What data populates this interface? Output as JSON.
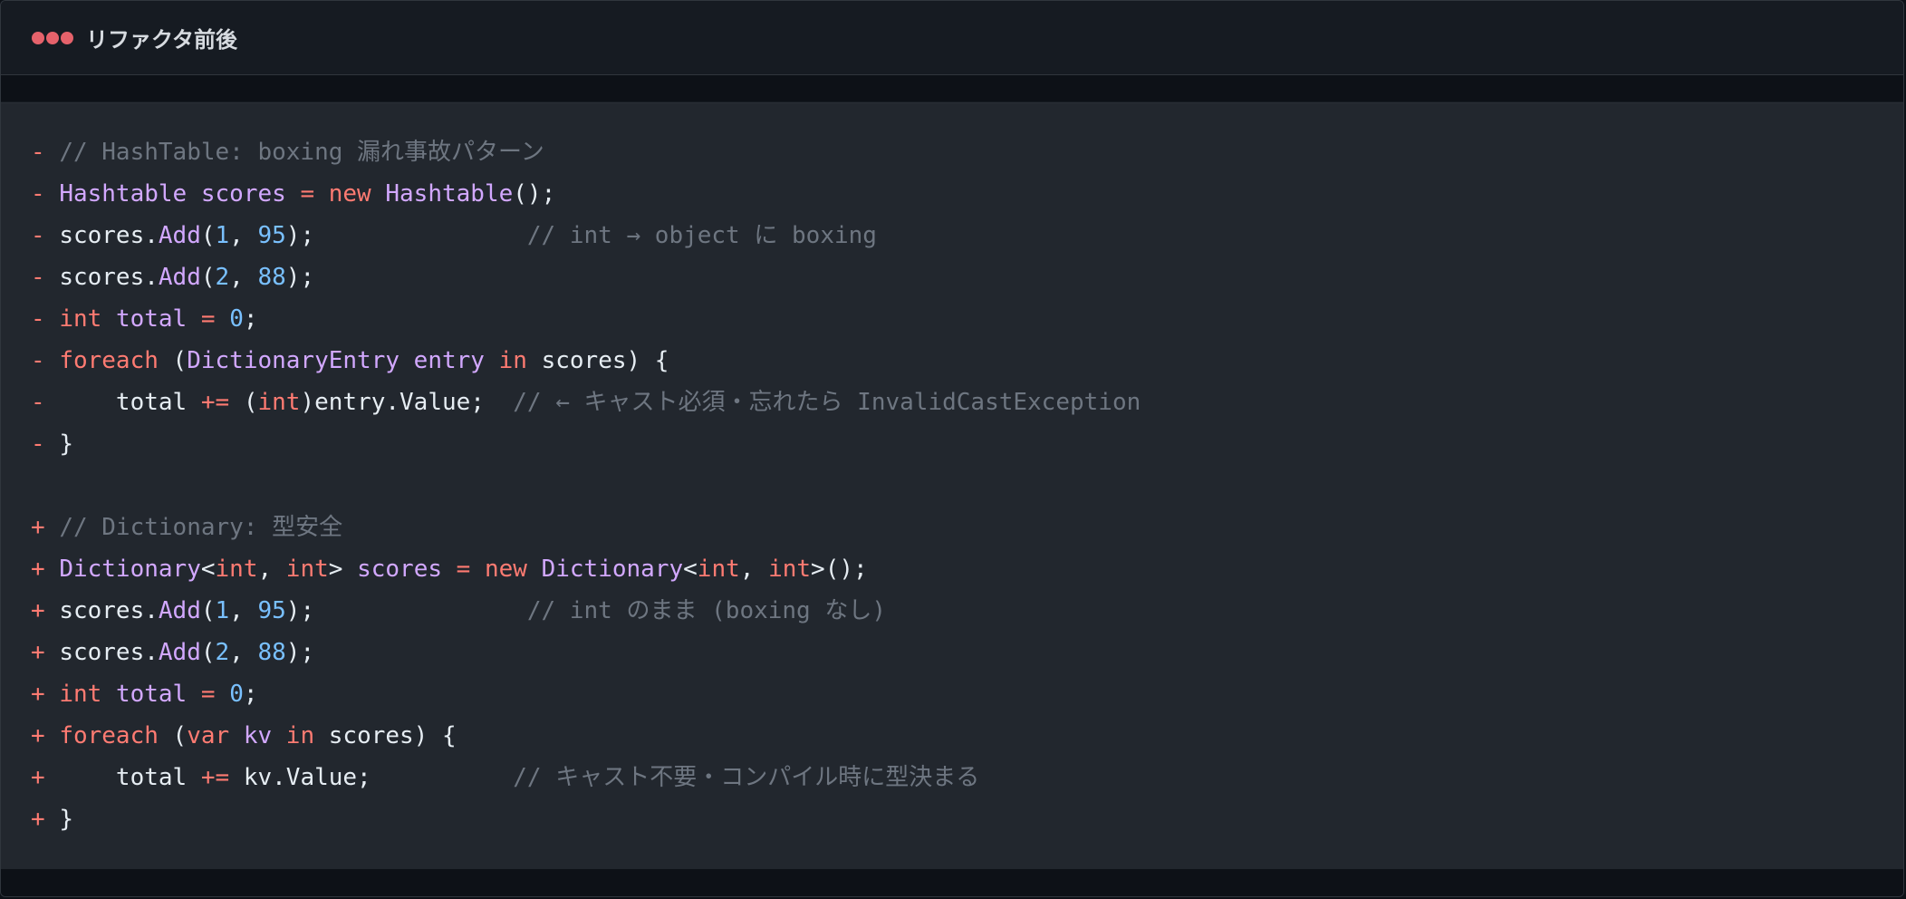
{
  "window": {
    "title": "リファクタ前後"
  },
  "colors": {
    "background": "#22272e",
    "titlebar": "#161b22",
    "diff_sign": "#ff7b72",
    "comment": "#6e7681",
    "type": "#d2a8ff",
    "keyword": "#ff7b72",
    "number": "#79c0ff",
    "plain": "#e6edf3"
  },
  "code": {
    "removed": [
      {
        "sign": "-",
        "tokens": [
          [
            "cm",
            "// HashTable: boxing 漏れ事故パターン"
          ]
        ]
      },
      {
        "sign": "-",
        "tokens": [
          [
            "ty",
            "Hashtable"
          ],
          [
            "tx",
            " "
          ],
          [
            "ty",
            "scores"
          ],
          [
            "tx",
            " "
          ],
          [
            "op",
            "="
          ],
          [
            "tx",
            " "
          ],
          [
            "kw",
            "new"
          ],
          [
            "tx",
            " "
          ],
          [
            "ty",
            "Hashtable"
          ],
          [
            "tx",
            "();"
          ]
        ]
      },
      {
        "sign": "-",
        "tokens": [
          [
            "tx",
            "scores."
          ],
          [
            "fn",
            "Add"
          ],
          [
            "tx",
            "("
          ],
          [
            "nm",
            "1"
          ],
          [
            "tx",
            ", "
          ],
          [
            "nm",
            "95"
          ],
          [
            "tx",
            ");               "
          ],
          [
            "cm",
            "// int → object に boxing"
          ]
        ]
      },
      {
        "sign": "-",
        "tokens": [
          [
            "tx",
            "scores."
          ],
          [
            "fn",
            "Add"
          ],
          [
            "tx",
            "("
          ],
          [
            "nm",
            "2"
          ],
          [
            "tx",
            ", "
          ],
          [
            "nm",
            "88"
          ],
          [
            "tx",
            ");"
          ]
        ]
      },
      {
        "sign": "-",
        "tokens": [
          [
            "kw",
            "int"
          ],
          [
            "tx",
            " "
          ],
          [
            "ty",
            "total"
          ],
          [
            "tx",
            " "
          ],
          [
            "op",
            "="
          ],
          [
            "tx",
            " "
          ],
          [
            "nm",
            "0"
          ],
          [
            "tx",
            ";"
          ]
        ]
      },
      {
        "sign": "-",
        "tokens": [
          [
            "kw",
            "foreach"
          ],
          [
            "tx",
            " ("
          ],
          [
            "ty",
            "DictionaryEntry"
          ],
          [
            "tx",
            " "
          ],
          [
            "ty",
            "entry"
          ],
          [
            "tx",
            " "
          ],
          [
            "kw",
            "in"
          ],
          [
            "tx",
            " scores) {"
          ]
        ]
      },
      {
        "sign": "-",
        "tokens": [
          [
            "tx",
            "    total "
          ],
          [
            "op",
            "+="
          ],
          [
            "tx",
            " ("
          ],
          [
            "kw",
            "int"
          ],
          [
            "tx",
            ")entry.Value;  "
          ],
          [
            "cm",
            "// ← キャスト必須・忘れたら InvalidCastException"
          ]
        ]
      },
      {
        "sign": "-",
        "tokens": [
          [
            "tx",
            "}"
          ]
        ]
      }
    ],
    "added": [
      {
        "sign": "+",
        "tokens": [
          [
            "cm",
            "// Dictionary: 型安全"
          ]
        ]
      },
      {
        "sign": "+",
        "tokens": [
          [
            "ty",
            "Dictionary"
          ],
          [
            "tx",
            "<"
          ],
          [
            "kw",
            "int"
          ],
          [
            "tx",
            ", "
          ],
          [
            "kw",
            "int"
          ],
          [
            "tx",
            "> "
          ],
          [
            "ty",
            "scores"
          ],
          [
            "tx",
            " "
          ],
          [
            "op",
            "="
          ],
          [
            "tx",
            " "
          ],
          [
            "kw",
            "new"
          ],
          [
            "tx",
            " "
          ],
          [
            "ty",
            "Dictionary"
          ],
          [
            "tx",
            "<"
          ],
          [
            "kw",
            "int"
          ],
          [
            "tx",
            ", "
          ],
          [
            "kw",
            "int"
          ],
          [
            "tx",
            ">();"
          ]
        ]
      },
      {
        "sign": "+",
        "tokens": [
          [
            "tx",
            "scores."
          ],
          [
            "fn",
            "Add"
          ],
          [
            "tx",
            "("
          ],
          [
            "nm",
            "1"
          ],
          [
            "tx",
            ", "
          ],
          [
            "nm",
            "95"
          ],
          [
            "tx",
            ");               "
          ],
          [
            "cm",
            "// int のまま (boxing なし)"
          ]
        ]
      },
      {
        "sign": "+",
        "tokens": [
          [
            "tx",
            "scores."
          ],
          [
            "fn",
            "Add"
          ],
          [
            "tx",
            "("
          ],
          [
            "nm",
            "2"
          ],
          [
            "tx",
            ", "
          ],
          [
            "nm",
            "88"
          ],
          [
            "tx",
            ");"
          ]
        ]
      },
      {
        "sign": "+",
        "tokens": [
          [
            "kw",
            "int"
          ],
          [
            "tx",
            " "
          ],
          [
            "ty",
            "total"
          ],
          [
            "tx",
            " "
          ],
          [
            "op",
            "="
          ],
          [
            "tx",
            " "
          ],
          [
            "nm",
            "0"
          ],
          [
            "tx",
            ";"
          ]
        ]
      },
      {
        "sign": "+",
        "tokens": [
          [
            "kw",
            "foreach"
          ],
          [
            "tx",
            " ("
          ],
          [
            "kw",
            "var"
          ],
          [
            "tx",
            " "
          ],
          [
            "ty",
            "kv"
          ],
          [
            "tx",
            " "
          ],
          [
            "kw",
            "in"
          ],
          [
            "tx",
            " scores) {"
          ]
        ]
      },
      {
        "sign": "+",
        "tokens": [
          [
            "tx",
            "    total "
          ],
          [
            "op",
            "+="
          ],
          [
            "tx",
            " kv.Value;          "
          ],
          [
            "cm",
            "// キャスト不要・コンパイル時に型決まる"
          ]
        ]
      },
      {
        "sign": "+",
        "tokens": [
          [
            "tx",
            "}"
          ]
        ]
      }
    ]
  }
}
